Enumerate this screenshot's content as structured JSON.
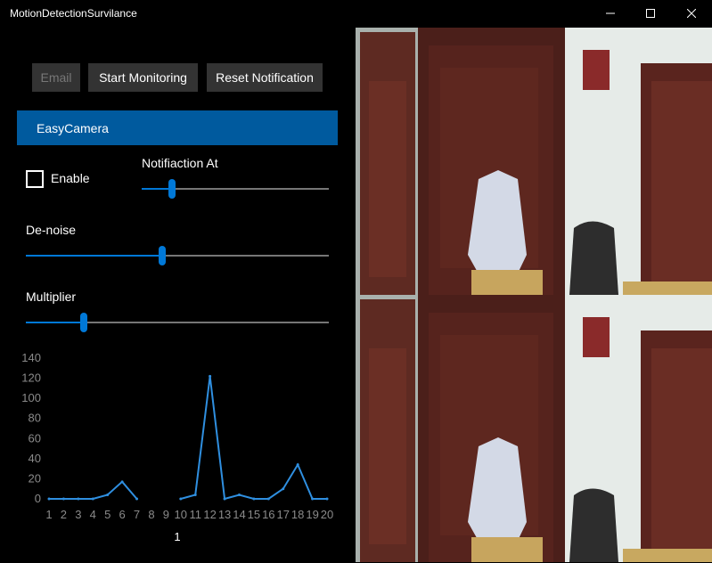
{
  "window": {
    "title": "MotionDetectionSurvilance",
    "minimize_icon": "minimize-icon",
    "maximize_icon": "maximize-icon",
    "close_icon": "close-icon"
  },
  "toolbar": {
    "email_label": "Email",
    "start_label": "Start Monitoring",
    "reset_label": "Reset Notification"
  },
  "camera": {
    "name": "EasyCamera"
  },
  "controls": {
    "enable_label": "Enable",
    "enable_checked": false,
    "notification_label": "Notifiaction At",
    "notification_value": 0.16,
    "denoise_label": "De-noise",
    "denoise_value": 0.45,
    "multiplier_label": "Multiplier",
    "multiplier_value": 0.19
  },
  "colors": {
    "accent": "#0078d7",
    "header_bg": "#005a9e",
    "button_bg": "#333333"
  },
  "chart_data": {
    "type": "line",
    "x": [
      "1",
      "2",
      "3",
      "4",
      "5",
      "6",
      "7",
      "8",
      "9",
      "10",
      "11",
      "12",
      "13",
      "14",
      "15",
      "16",
      "17",
      "18",
      "19",
      "20"
    ],
    "values": [
      0,
      0,
      0,
      0,
      4,
      17,
      0,
      null,
      null,
      0,
      4,
      122,
      0,
      4,
      0,
      0,
      10,
      34,
      0,
      0
    ],
    "ylim": [
      0,
      140
    ],
    "yticks": [
      "140",
      "120",
      "100",
      "80",
      "60",
      "40",
      "20",
      "0"
    ],
    "xlabel": "1",
    "grid": false
  }
}
